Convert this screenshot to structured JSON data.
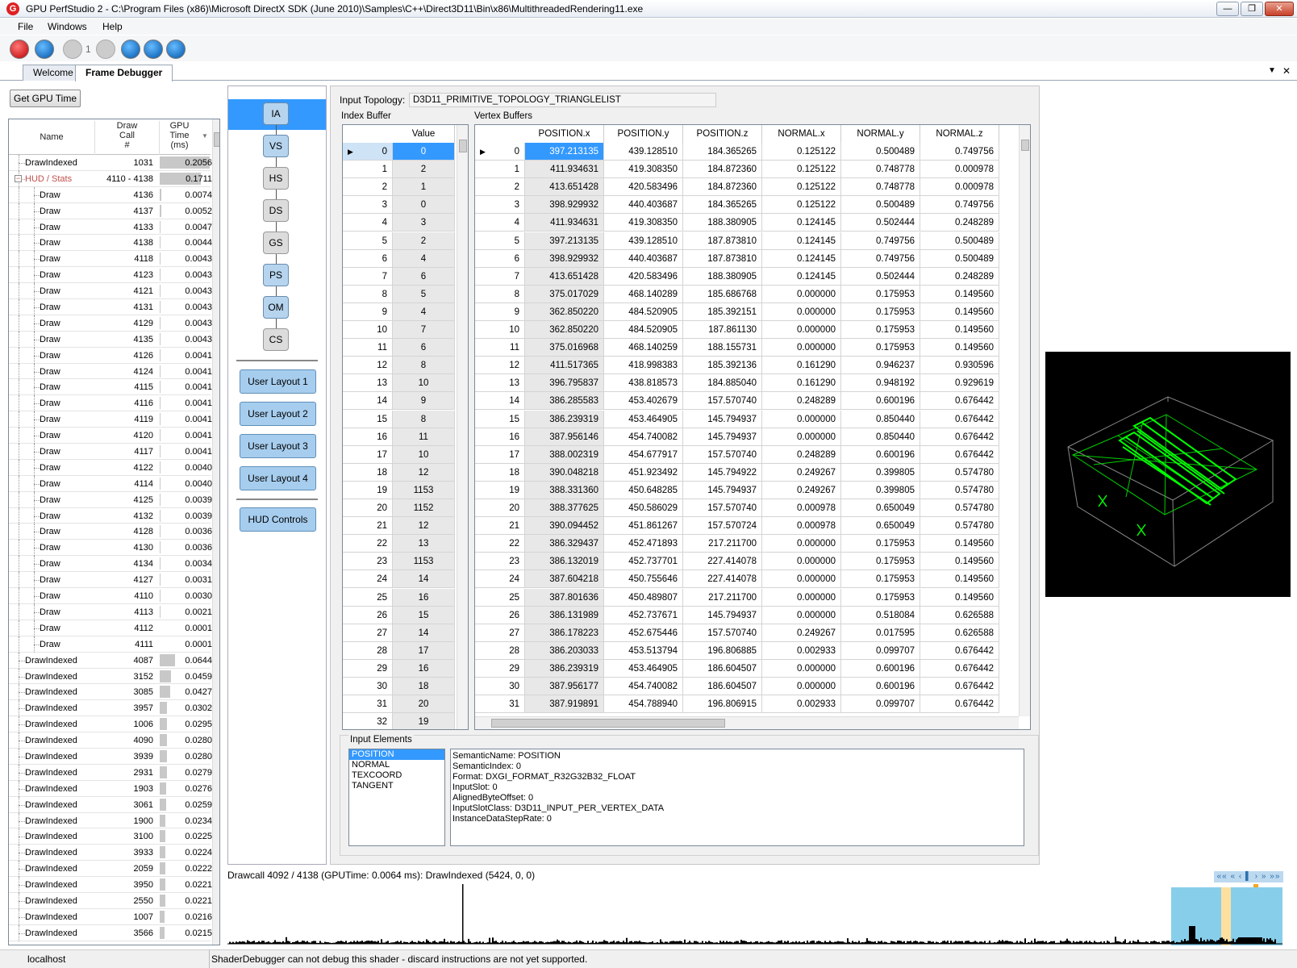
{
  "window": {
    "title": "GPU PerfStudio 2 - C:\\Program Files (x86)\\Microsoft DirectX SDK (June 2010)\\Samples\\C++\\Direct3D11\\Bin\\x86\\MultithreadedRendering11.exe",
    "icon_letter": "G",
    "minimize": "—",
    "restore": "❐",
    "close": "✕"
  },
  "menu": [
    "File",
    "Windows",
    "Help"
  ],
  "toolbar": {
    "frame_counter": "1"
  },
  "tabs": [
    {
      "label": "Welcome"
    },
    {
      "label": "Frame Debugger"
    }
  ],
  "tab_controls": {
    "dropdown": "▼",
    "close": "✕"
  },
  "get_gpu_time_label": "Get GPU Time",
  "tree": {
    "headers": {
      "name": "Name",
      "draw_call": "Draw\nCall\n#",
      "gpu_time": "GPU\nTime\n(ms)"
    },
    "rows": [
      {
        "name": "DrawIndexed",
        "dc": "1031",
        "gt": "0.2056",
        "bar": 1.0,
        "level": 0
      },
      {
        "name": "HUD / Stats",
        "dc": "4110 - 4138",
        "gt": "0.1711",
        "bar": 0.83,
        "level": 0,
        "group": true
      },
      {
        "name": "Draw",
        "dc": "4136",
        "gt": "0.0074",
        "bar": 0.036,
        "level": 1
      },
      {
        "name": "Draw",
        "dc": "4137",
        "gt": "0.0052",
        "bar": 0.025,
        "level": 1
      },
      {
        "name": "Draw",
        "dc": "4133",
        "gt": "0.0047",
        "bar": 0.023,
        "level": 1
      },
      {
        "name": "Draw",
        "dc": "4138",
        "gt": "0.0044",
        "bar": 0.021,
        "level": 1
      },
      {
        "name": "Draw",
        "dc": "4118",
        "gt": "0.0043",
        "bar": 0.021,
        "level": 1
      },
      {
        "name": "Draw",
        "dc": "4123",
        "gt": "0.0043",
        "bar": 0.021,
        "level": 1
      },
      {
        "name": "Draw",
        "dc": "4121",
        "gt": "0.0043",
        "bar": 0.021,
        "level": 1
      },
      {
        "name": "Draw",
        "dc": "4131",
        "gt": "0.0043",
        "bar": 0.021,
        "level": 1
      },
      {
        "name": "Draw",
        "dc": "4129",
        "gt": "0.0043",
        "bar": 0.021,
        "level": 1
      },
      {
        "name": "Draw",
        "dc": "4135",
        "gt": "0.0043",
        "bar": 0.021,
        "level": 1
      },
      {
        "name": "Draw",
        "dc": "4126",
        "gt": "0.0041",
        "bar": 0.02,
        "level": 1
      },
      {
        "name": "Draw",
        "dc": "4124",
        "gt": "0.0041",
        "bar": 0.02,
        "level": 1
      },
      {
        "name": "Draw",
        "dc": "4115",
        "gt": "0.0041",
        "bar": 0.02,
        "level": 1
      },
      {
        "name": "Draw",
        "dc": "4116",
        "gt": "0.0041",
        "bar": 0.02,
        "level": 1
      },
      {
        "name": "Draw",
        "dc": "4119",
        "gt": "0.0041",
        "bar": 0.02,
        "level": 1
      },
      {
        "name": "Draw",
        "dc": "4120",
        "gt": "0.0041",
        "bar": 0.02,
        "level": 1
      },
      {
        "name": "Draw",
        "dc": "4117",
        "gt": "0.0041",
        "bar": 0.02,
        "level": 1
      },
      {
        "name": "Draw",
        "dc": "4122",
        "gt": "0.0040",
        "bar": 0.019,
        "level": 1
      },
      {
        "name": "Draw",
        "dc": "4114",
        "gt": "0.0040",
        "bar": 0.019,
        "level": 1
      },
      {
        "name": "Draw",
        "dc": "4125",
        "gt": "0.0039",
        "bar": 0.019,
        "level": 1
      },
      {
        "name": "Draw",
        "dc": "4132",
        "gt": "0.0039",
        "bar": 0.019,
        "level": 1
      },
      {
        "name": "Draw",
        "dc": "4128",
        "gt": "0.0036",
        "bar": 0.017,
        "level": 1
      },
      {
        "name": "Draw",
        "dc": "4130",
        "gt": "0.0036",
        "bar": 0.017,
        "level": 1
      },
      {
        "name": "Draw",
        "dc": "4134",
        "gt": "0.0034",
        "bar": 0.016,
        "level": 1
      },
      {
        "name": "Draw",
        "dc": "4127",
        "gt": "0.0031",
        "bar": 0.015,
        "level": 1
      },
      {
        "name": "Draw",
        "dc": "4110",
        "gt": "0.0030",
        "bar": 0.015,
        "level": 1
      },
      {
        "name": "Draw",
        "dc": "4113",
        "gt": "0.0021",
        "bar": 0.01,
        "level": 1
      },
      {
        "name": "Draw",
        "dc": "4112",
        "gt": "0.0001",
        "bar": 0.0,
        "level": 1
      },
      {
        "name": "Draw",
        "dc": "4111",
        "gt": "0.0001",
        "bar": 0.0,
        "level": 1
      },
      {
        "name": "DrawIndexed",
        "dc": "4087",
        "gt": "0.0644",
        "bar": 0.31,
        "level": 0
      },
      {
        "name": "DrawIndexed",
        "dc": "3152",
        "gt": "0.0459",
        "bar": 0.22,
        "level": 0
      },
      {
        "name": "DrawIndexed",
        "dc": "3085",
        "gt": "0.0427",
        "bar": 0.21,
        "level": 0
      },
      {
        "name": "DrawIndexed",
        "dc": "3957",
        "gt": "0.0302",
        "bar": 0.15,
        "level": 0
      },
      {
        "name": "DrawIndexed",
        "dc": "1006",
        "gt": "0.0295",
        "bar": 0.14,
        "level": 0
      },
      {
        "name": "DrawIndexed",
        "dc": "4090",
        "gt": "0.0280",
        "bar": 0.14,
        "level": 0
      },
      {
        "name": "DrawIndexed",
        "dc": "3939",
        "gt": "0.0280",
        "bar": 0.14,
        "level": 0
      },
      {
        "name": "DrawIndexed",
        "dc": "2931",
        "gt": "0.0279",
        "bar": 0.14,
        "level": 0
      },
      {
        "name": "DrawIndexed",
        "dc": "1903",
        "gt": "0.0276",
        "bar": 0.13,
        "level": 0
      },
      {
        "name": "DrawIndexed",
        "dc": "3061",
        "gt": "0.0259",
        "bar": 0.13,
        "level": 0
      },
      {
        "name": "DrawIndexed",
        "dc": "1900",
        "gt": "0.0234",
        "bar": 0.11,
        "level": 0
      },
      {
        "name": "DrawIndexed",
        "dc": "3100",
        "gt": "0.0225",
        "bar": 0.11,
        "level": 0
      },
      {
        "name": "DrawIndexed",
        "dc": "3933",
        "gt": "0.0224",
        "bar": 0.11,
        "level": 0
      },
      {
        "name": "DrawIndexed",
        "dc": "2059",
        "gt": "0.0222",
        "bar": 0.11,
        "level": 0
      },
      {
        "name": "DrawIndexed",
        "dc": "3950",
        "gt": "0.0221",
        "bar": 0.11,
        "level": 0
      },
      {
        "name": "DrawIndexed",
        "dc": "2550",
        "gt": "0.0221",
        "bar": 0.11,
        "level": 0
      },
      {
        "name": "DrawIndexed",
        "dc": "1007",
        "gt": "0.0216",
        "bar": 0.1,
        "level": 0
      },
      {
        "name": "DrawIndexed",
        "dc": "3566",
        "gt": "0.0215",
        "bar": 0.1,
        "level": 0
      }
    ]
  },
  "pipeline": {
    "stages": [
      {
        "label": "IA",
        "active": true
      },
      {
        "label": "VS",
        "active": true
      },
      {
        "label": "HS",
        "active": false
      },
      {
        "label": "DS",
        "active": false
      },
      {
        "label": "GS",
        "active": false
      },
      {
        "label": "PS",
        "active": true
      },
      {
        "label": "OM",
        "active": true
      },
      {
        "label": "CS",
        "active": false
      }
    ],
    "user_layouts": [
      "User Layout 1",
      "User Layout 2",
      "User Layout 3",
      "User Layout 4"
    ],
    "hud_controls": "HUD Controls"
  },
  "ia": {
    "topology_label": "Input Topology:",
    "topology_value": "D3D11_PRIMITIVE_TOPOLOGY_TRIANGLELIST",
    "index_buffer_label": "Index Buffer",
    "vertex_buffers_label": "Vertex Buffers",
    "index_header": "Value",
    "index_rows": [
      [
        "0",
        "0"
      ],
      [
        "1",
        "2"
      ],
      [
        "2",
        "1"
      ],
      [
        "3",
        "0"
      ],
      [
        "4",
        "3"
      ],
      [
        "5",
        "2"
      ],
      [
        "6",
        "4"
      ],
      [
        "7",
        "6"
      ],
      [
        "8",
        "5"
      ],
      [
        "9",
        "4"
      ],
      [
        "10",
        "7"
      ],
      [
        "11",
        "6"
      ],
      [
        "12",
        "8"
      ],
      [
        "13",
        "10"
      ],
      [
        "14",
        "9"
      ],
      [
        "15",
        "8"
      ],
      [
        "16",
        "11"
      ],
      [
        "17",
        "10"
      ],
      [
        "18",
        "12"
      ],
      [
        "19",
        "1153"
      ],
      [
        "20",
        "1152"
      ],
      [
        "21",
        "12"
      ],
      [
        "22",
        "13"
      ],
      [
        "23",
        "1153"
      ],
      [
        "24",
        "14"
      ],
      [
        "25",
        "16"
      ],
      [
        "26",
        "15"
      ],
      [
        "27",
        "14"
      ],
      [
        "28",
        "17"
      ],
      [
        "29",
        "16"
      ],
      [
        "30",
        "18"
      ],
      [
        "31",
        "20"
      ],
      [
        "32",
        "19"
      ]
    ],
    "vertex_headers": [
      "POSITION.x",
      "POSITION.y",
      "POSITION.z",
      "NORMAL.x",
      "NORMAL.y",
      "NORMAL.z"
    ],
    "vertex_rows": [
      [
        "0",
        "397.213135",
        "439.128510",
        "184.365265",
        "0.125122",
        "0.500489",
        "0.749756"
      ],
      [
        "1",
        "411.934631",
        "419.308350",
        "184.872360",
        "0.125122",
        "0.748778",
        "0.000978"
      ],
      [
        "2",
        "413.651428",
        "420.583496",
        "184.872360",
        "0.125122",
        "0.748778",
        "0.000978"
      ],
      [
        "3",
        "398.929932",
        "440.403687",
        "184.365265",
        "0.125122",
        "0.500489",
        "0.749756"
      ],
      [
        "4",
        "411.934631",
        "419.308350",
        "188.380905",
        "0.124145",
        "0.502444",
        "0.248289"
      ],
      [
        "5",
        "397.213135",
        "439.128510",
        "187.873810",
        "0.124145",
        "0.749756",
        "0.500489"
      ],
      [
        "6",
        "398.929932",
        "440.403687",
        "187.873810",
        "0.124145",
        "0.749756",
        "0.500489"
      ],
      [
        "7",
        "413.651428",
        "420.583496",
        "188.380905",
        "0.124145",
        "0.502444",
        "0.248289"
      ],
      [
        "8",
        "375.017029",
        "468.140289",
        "185.686768",
        "0.000000",
        "0.175953",
        "0.149560"
      ],
      [
        "9",
        "362.850220",
        "484.520905",
        "185.392151",
        "0.000000",
        "0.175953",
        "0.149560"
      ],
      [
        "10",
        "362.850220",
        "484.520905",
        "187.861130",
        "0.000000",
        "0.175953",
        "0.149560"
      ],
      [
        "11",
        "375.016968",
        "468.140259",
        "188.155731",
        "0.000000",
        "0.175953",
        "0.149560"
      ],
      [
        "12",
        "411.517365",
        "418.998383",
        "185.392136",
        "0.161290",
        "0.946237",
        "0.930596"
      ],
      [
        "13",
        "396.795837",
        "438.818573",
        "184.885040",
        "0.161290",
        "0.948192",
        "0.929619"
      ],
      [
        "14",
        "386.285583",
        "453.402679",
        "157.570740",
        "0.248289",
        "0.600196",
        "0.676442"
      ],
      [
        "15",
        "386.239319",
        "453.464905",
        "145.794937",
        "0.000000",
        "0.850440",
        "0.676442"
      ],
      [
        "16",
        "387.956146",
        "454.740082",
        "145.794937",
        "0.000000",
        "0.850440",
        "0.676442"
      ],
      [
        "17",
        "388.002319",
        "454.677917",
        "157.570740",
        "0.248289",
        "0.600196",
        "0.676442"
      ],
      [
        "18",
        "390.048218",
        "451.923492",
        "145.794922",
        "0.249267",
        "0.399805",
        "0.574780"
      ],
      [
        "19",
        "388.331360",
        "450.648285",
        "145.794937",
        "0.249267",
        "0.399805",
        "0.574780"
      ],
      [
        "20",
        "388.377625",
        "450.586029",
        "157.570740",
        "0.000978",
        "0.650049",
        "0.574780"
      ],
      [
        "21",
        "390.094452",
        "451.861267",
        "157.570724",
        "0.000978",
        "0.650049",
        "0.574780"
      ],
      [
        "22",
        "386.329437",
        "452.471893",
        "217.211700",
        "0.000000",
        "0.175953",
        "0.149560"
      ],
      [
        "23",
        "386.132019",
        "452.737701",
        "227.414078",
        "0.000000",
        "0.175953",
        "0.149560"
      ],
      [
        "24",
        "387.604218",
        "450.755646",
        "227.414078",
        "0.000000",
        "0.175953",
        "0.149560"
      ],
      [
        "25",
        "387.801636",
        "450.489807",
        "217.211700",
        "0.000000",
        "0.175953",
        "0.149560"
      ],
      [
        "26",
        "386.131989",
        "452.737671",
        "145.794937",
        "0.000000",
        "0.518084",
        "0.626588"
      ],
      [
        "27",
        "386.178223",
        "452.675446",
        "157.570740",
        "0.249267",
        "0.017595",
        "0.626588"
      ],
      [
        "28",
        "386.203033",
        "453.513794",
        "196.806885",
        "0.002933",
        "0.099707",
        "0.676442"
      ],
      [
        "29",
        "386.239319",
        "453.464905",
        "186.604507",
        "0.000000",
        "0.600196",
        "0.676442"
      ],
      [
        "30",
        "387.956177",
        "454.740082",
        "186.604507",
        "0.000000",
        "0.600196",
        "0.676442"
      ],
      [
        "31",
        "387.919891",
        "454.788940",
        "196.806915",
        "0.002933",
        "0.099707",
        "0.676442"
      ]
    ],
    "input_elements_label": "Input Elements",
    "input_elements": [
      "POSITION",
      "NORMAL",
      "TEXCOORD",
      "TANGENT"
    ],
    "element_detail": [
      "SemanticName: POSITION",
      "SemanticIndex: 0",
      "Format: DXGI_FORMAT_R32G32B32_FLOAT",
      "InputSlot: 0",
      "AlignedByteOffset: 0",
      "InputSlotClass: D3D11_INPUT_PER_VERTEX_DATA",
      "InstanceDataStepRate: 0"
    ]
  },
  "timeline": {
    "status": "Drawcall 4092 / 4138 (GPUTime: 0.0064 ms): DrawIndexed (5424, 0, 0)",
    "nav": "«« « ‹ ▌ › » »»"
  },
  "statusbar": {
    "host": "localhost",
    "message": "ShaderDebugger can not debug this shader - discard instructions are not yet supported."
  },
  "colors": {
    "accent": "#3399ff",
    "stage_active": "#b6d4ee",
    "wireframe": "#00e000",
    "timeline_highlight": "#87ceeb"
  }
}
